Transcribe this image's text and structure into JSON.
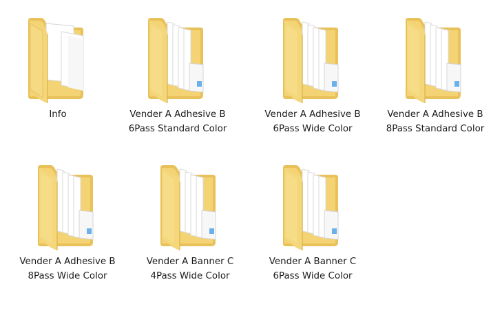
{
  "window": {
    "view": "Large icons",
    "background": "#ffffff"
  },
  "folders": [
    {
      "label": "Info",
      "icon": "folder-with-documents-icon",
      "open_style": "documents"
    },
    {
      "label": "Vender A Adhesive B 6Pass Standard Color",
      "icon": "folder-with-files-icon",
      "open_style": "files"
    },
    {
      "label": "Vender A Adhesive B 6Pass Wide Color",
      "icon": "folder-with-files-icon",
      "open_style": "files"
    },
    {
      "label": "Vender A Adhesive B 8Pass Standard Color",
      "icon": "folder-with-files-icon",
      "open_style": "files"
    },
    {
      "label": "Vender A Adhesive B 8Pass Wide Color",
      "icon": "folder-with-files-icon",
      "open_style": "files"
    },
    {
      "label": "Vender A Banner C 4Pass Wide Color",
      "icon": "folder-with-files-icon",
      "open_style": "files"
    },
    {
      "label": "Vender A Banner C 6Pass Wide Color",
      "icon": "folder-with-files-icon",
      "open_style": "files"
    }
  ],
  "colors": {
    "folder_front": "#f6d56f",
    "folder_front_shadow": "#dcb44f",
    "folder_back": "#e9c35b",
    "paper": "#ffffff",
    "paper_shadow": "#d9d9d9",
    "accent_blue": "#5aa7e8"
  }
}
